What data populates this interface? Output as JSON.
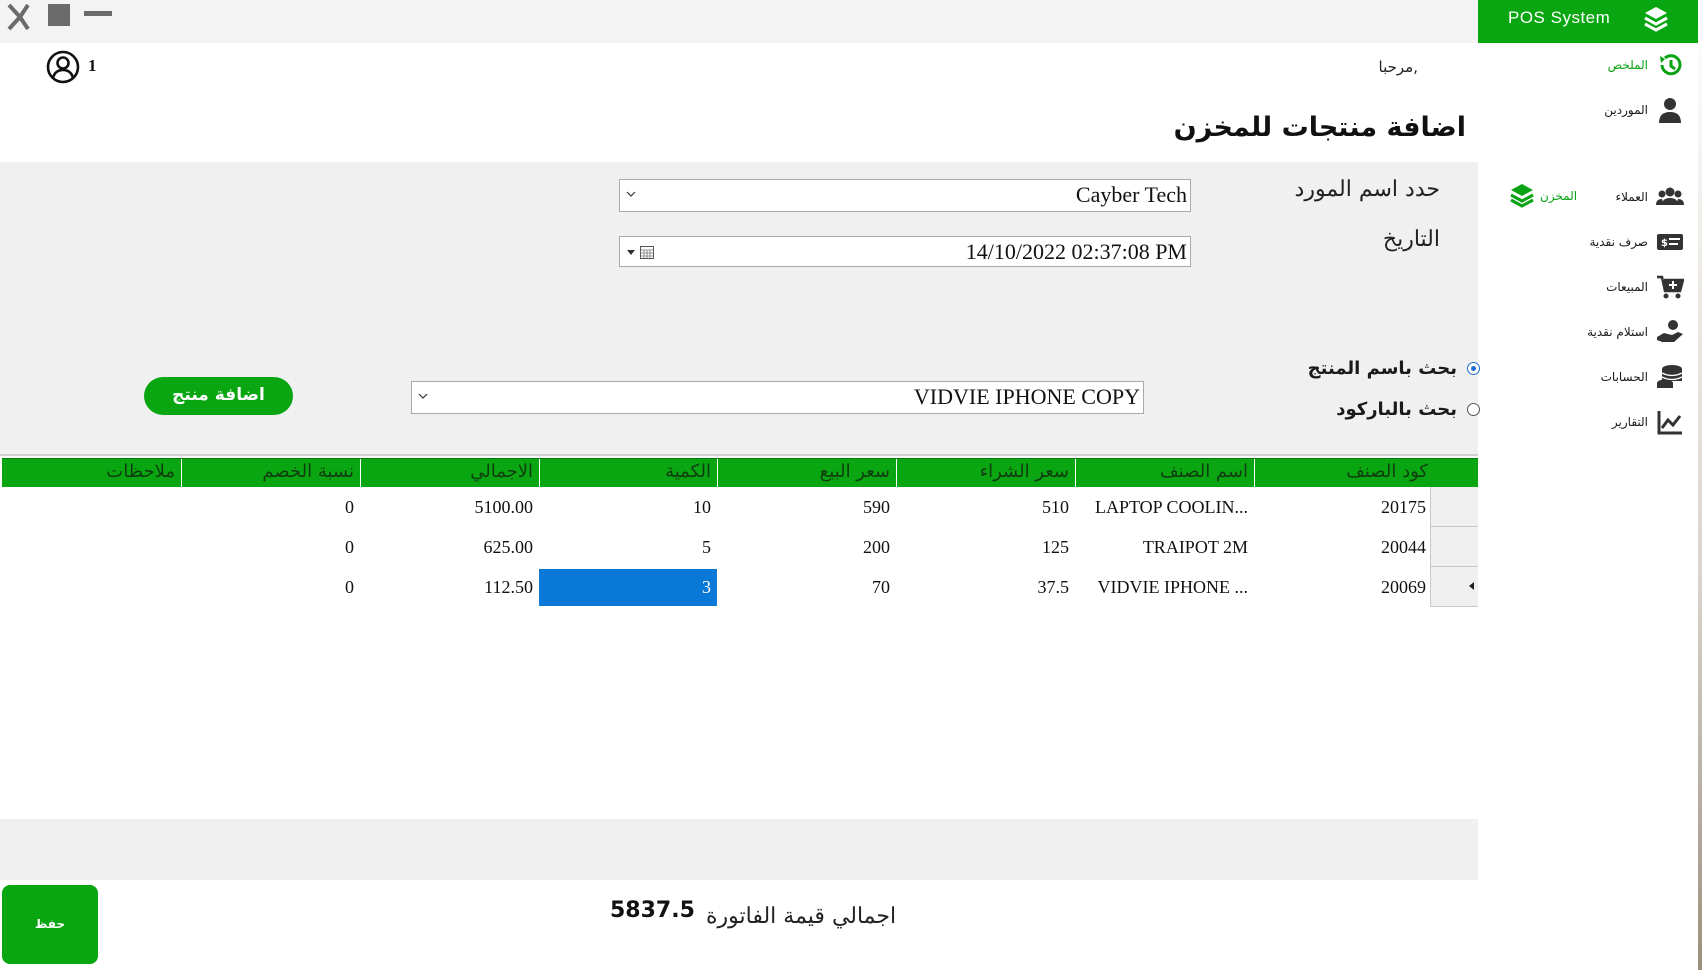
{
  "brand": {
    "title": "POS  System"
  },
  "header": {
    "user_count": "1",
    "greeting": "مرحبا,",
    "page_title": "اضافة منتجات للمخزن"
  },
  "sidebar": {
    "items": [
      {
        "label": "الملخص",
        "icon": "history-icon",
        "active": true
      },
      {
        "label": "الموردين",
        "icon": "user-tie-icon"
      },
      {
        "label": "المخزن",
        "icon": "layers-icon",
        "active": true
      },
      {
        "label": "العملاء",
        "icon": "users-icon"
      },
      {
        "label": "صرف نقدية",
        "icon": "money-check-icon"
      },
      {
        "label": "المبيعات",
        "icon": "cart-plus-icon"
      },
      {
        "label": "استلام نقدية",
        "icon": "hand-coin-icon"
      },
      {
        "label": "الحسابات",
        "icon": "coins-stack-icon"
      },
      {
        "label": "التقارير",
        "icon": "chart-line-icon"
      }
    ]
  },
  "form": {
    "supplier_label": "حدد اسم المورد",
    "supplier_value": "Cayber Tech",
    "date_label": "التاريخ",
    "date_value": "14/10/2022 02:37:08   PM",
    "search_by_name": "بحث باسم المنتج",
    "search_by_barcode": "بحث بالباركود",
    "product_value": "VIDVIE IPHONE COPY",
    "add_button": "اضافة منتج"
  },
  "grid": {
    "columns": [
      "كود الصنف",
      "اسم الصنف",
      "سعر الشراء",
      "سعر البيع",
      "الكمية",
      "الاجمالي",
      "نسبة الخصم",
      "ملاحظات"
    ],
    "rows": [
      {
        "code": "20175",
        "name": "LAPTOP COOLIN...",
        "buy": "510",
        "sell": "590",
        "qty": "10",
        "total": "5100.00",
        "discount": "0",
        "notes": ""
      },
      {
        "code": "20044",
        "name": "TRAIPOT 2M",
        "buy": "125",
        "sell": "200",
        "qty": "5",
        "total": "625.00",
        "discount": "0",
        "notes": ""
      },
      {
        "code": "20069",
        "name": "VIDVIE IPHONE ...",
        "buy": "37.5",
        "sell": "70",
        "qty": "3",
        "total": "112.50",
        "discount": "0",
        "notes": ""
      }
    ]
  },
  "footer": {
    "save_button": "حفظ",
    "total_label": "اجمالي قيمة الفاتورة",
    "total_value": "5837.5"
  },
  "colors": {
    "accent": "#09a612",
    "selection": "#0a78d7",
    "active_nav": "#0aa314"
  }
}
